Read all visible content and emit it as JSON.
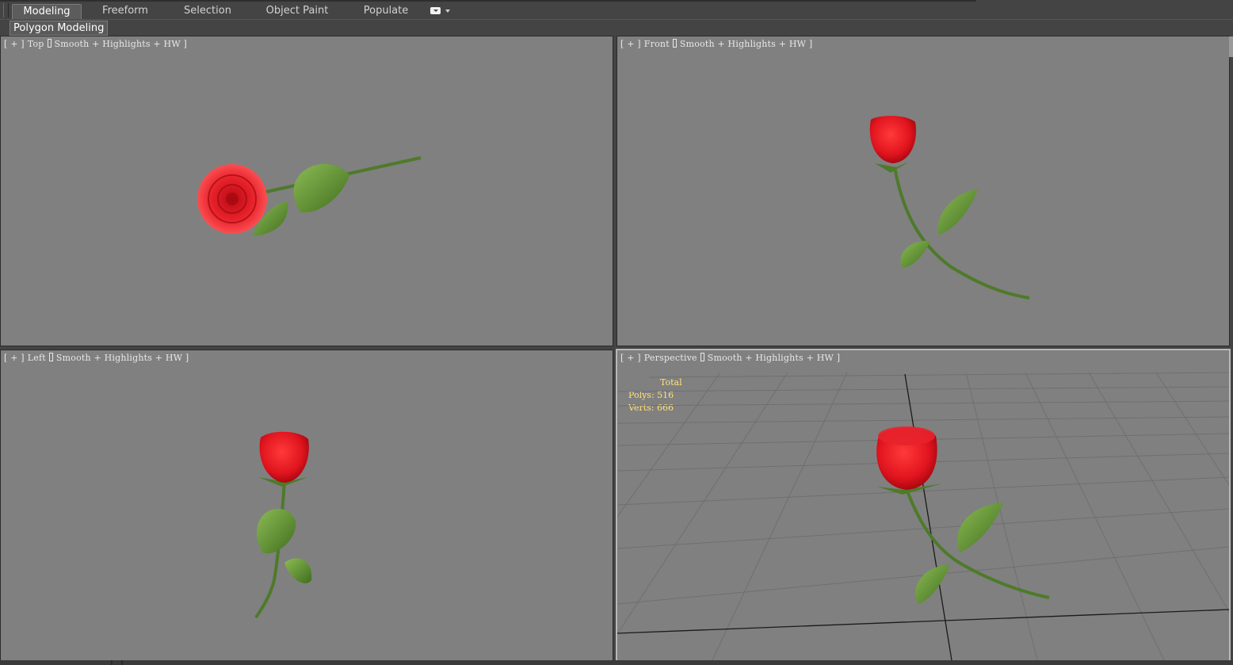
{
  "ribbon": {
    "tabs": [
      {
        "label": "Modeling",
        "active": true
      },
      {
        "label": "Freeform",
        "active": false
      },
      {
        "label": "Selection",
        "active": false
      },
      {
        "label": "Object Paint",
        "active": false
      },
      {
        "label": "Populate",
        "active": false
      }
    ],
    "panel_label": "Polygon Modeling"
  },
  "viewports": {
    "top": {
      "plus": "[ + ]",
      "view": "Top",
      "shading": "Smooth + Highlights + HW ]"
    },
    "front": {
      "plus": "[ + ]",
      "view": "Front",
      "shading": "Smooth + Highlights + HW ]"
    },
    "left": {
      "plus": "[ + ]",
      "view": "Left",
      "shading": "Smooth + Highlights + HW ]"
    },
    "perspective": {
      "plus": "[ + ]",
      "view": "Perspective",
      "shading": "Smooth + Highlights + HW ]"
    }
  },
  "stats": {
    "header": "Total",
    "polys_label": "Polys:",
    "polys": "516",
    "verts_label": "Verts:",
    "verts": "666"
  },
  "colors": {
    "viewport_bg": "#808080",
    "ui_bg": "#444444",
    "rose": "#e0141e",
    "leaf": "#5a8f2c",
    "stats_text": "#ffe27a",
    "grid": "#6f6f6f"
  }
}
